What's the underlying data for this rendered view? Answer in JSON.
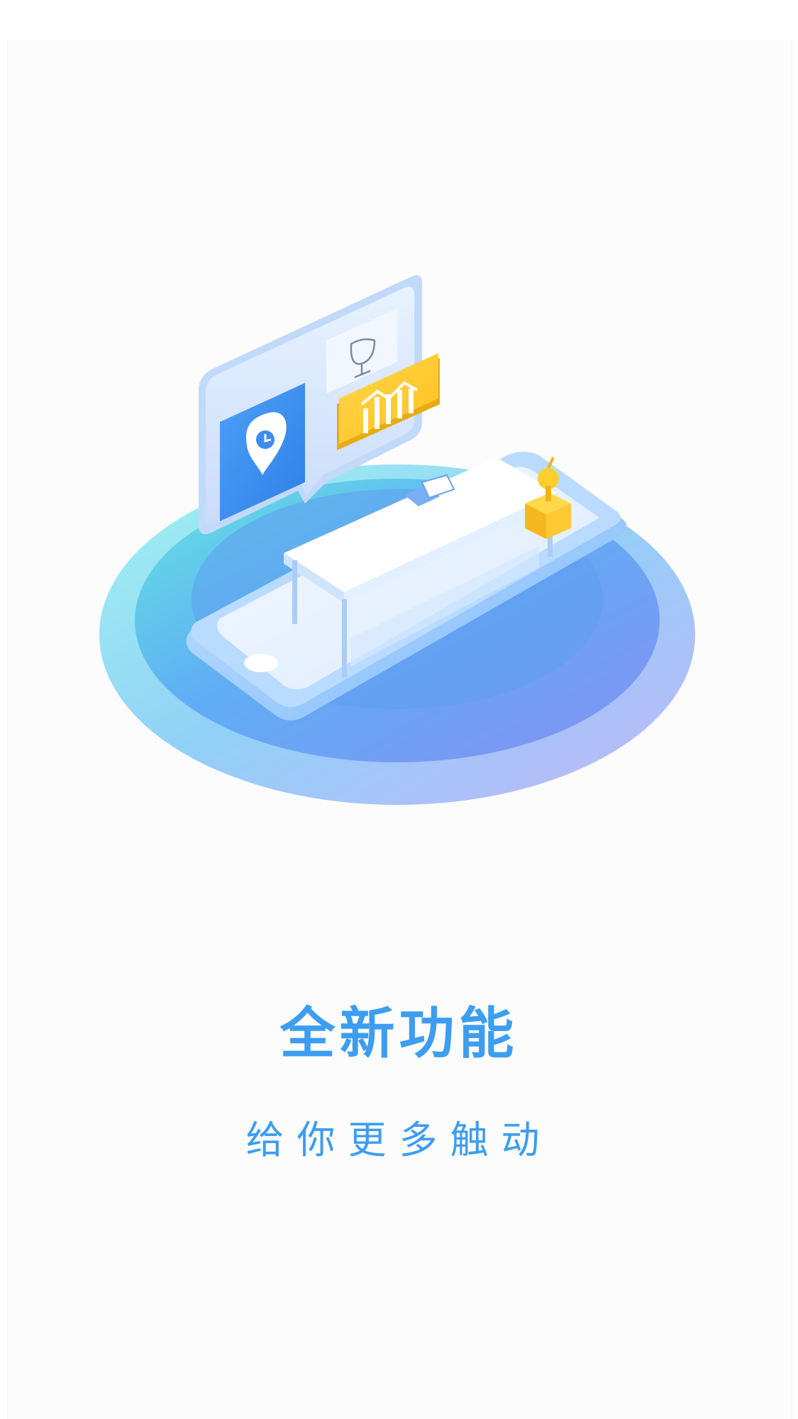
{
  "onboarding": {
    "title": "全新功能",
    "subtitle": "给你更多触动"
  },
  "colors": {
    "accent": "#3d9df0",
    "background": "#fefefe",
    "platform_teal": "#6fe3e0",
    "platform_purple": "#8c9ff5",
    "card_blue": "#3a8cf0",
    "card_yellow": "#ffcc33"
  },
  "icons": [
    "location-pin-icon",
    "trophy-icon",
    "bar-chart-icon",
    "pencil-icon",
    "hand-bell-icon"
  ]
}
